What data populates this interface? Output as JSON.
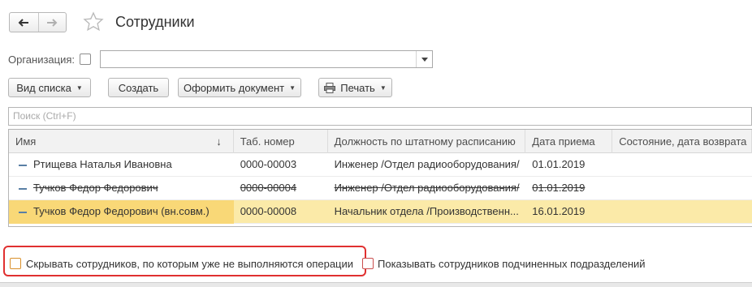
{
  "header": {
    "title": "Сотрудники"
  },
  "filter": {
    "org_label": "Организация:",
    "org_value": ""
  },
  "toolbar": {
    "view_list": "Вид списка",
    "create": "Создать",
    "make_doc": "Оформить документ",
    "print": "Печать"
  },
  "search": {
    "placeholder": "Поиск (Ctrl+F)"
  },
  "table": {
    "columns": [
      "Имя",
      "Таб. номер",
      "Должность по штатному расписанию",
      "Дата приема",
      "Состояние, дата возврата"
    ],
    "sort_indicator": "↓",
    "rows": [
      {
        "name": "Ртищева Наталья Ивановна",
        "tab": "0000-00003",
        "position": "Инженер /Отдел радиооборудования/",
        "date": "01.01.2019",
        "state": ""
      },
      {
        "name": "Тучков Федор Федорович",
        "tab": "0000-00004",
        "position": "Инженер /Отдел радиооборудования/",
        "date": "01.01.2019",
        "state": ""
      },
      {
        "name": "Тучков Федор Федорович (вн.совм.)",
        "tab": "0000-00008",
        "position": "Начальник отдела /Производственн...",
        "date": "16.01.2019",
        "state": ""
      }
    ]
  },
  "options": {
    "hide_label": "Скрывать сотрудников, по которым уже не выполняются операции",
    "show_label": "Показывать сотрудников подчиненных подразделений"
  }
}
